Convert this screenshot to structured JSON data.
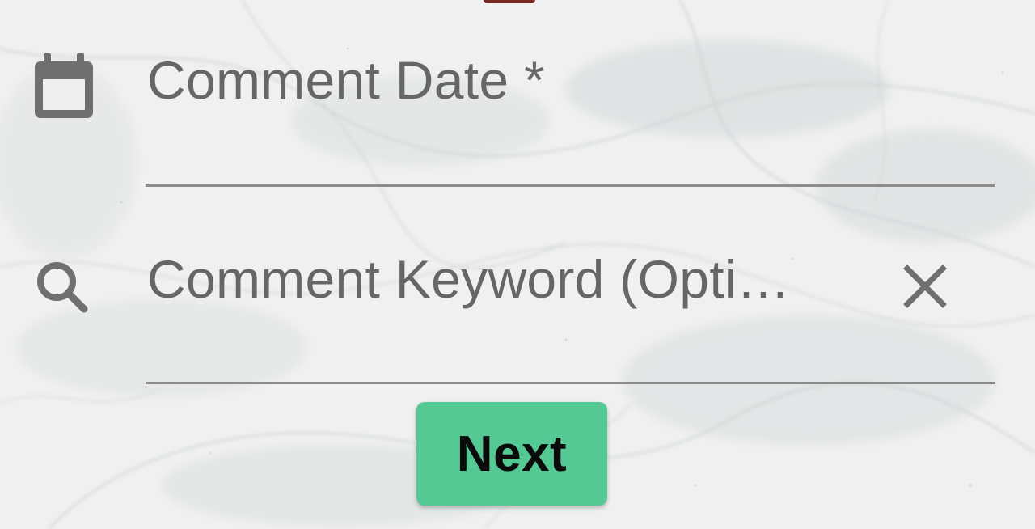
{
  "form": {
    "date_field": {
      "label": "Comment Date *",
      "icon": "calendar-icon"
    },
    "keyword_field": {
      "label": "Comment Keyword (Opti…",
      "icon": "search-icon",
      "clear_icon": "close-icon"
    },
    "next_button": {
      "label": "Next"
    }
  },
  "colors": {
    "accent": "#54c994",
    "icon": "#6f6f6f",
    "label": "#666666",
    "underline": "#8c8c8c",
    "top_accent": "#7a2a22"
  }
}
